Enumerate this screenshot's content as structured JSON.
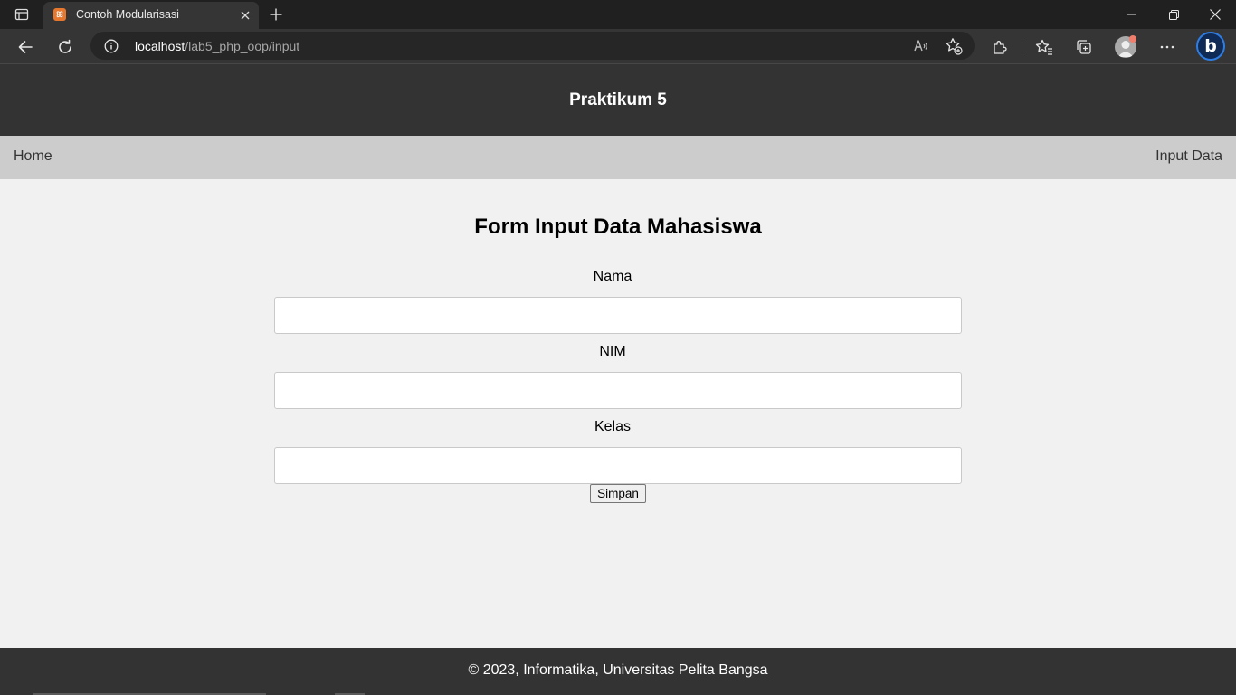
{
  "browser": {
    "tab": {
      "title": "Contoh Modularisasi",
      "favicon_glyph": "ꕤ",
      "favicon_color": "#e8772e"
    },
    "address": {
      "host": "localhost",
      "path": "/lab5_php_oop/input"
    },
    "bing_glyph": "b",
    "icons": {
      "tab_actions": "tab-actions-icon",
      "close": "close-icon",
      "new_tab": "plus-icon",
      "minimize": "minimize-icon",
      "restore": "restore-icon",
      "window_close": "window-close-icon",
      "back": "back-arrow-icon",
      "refresh": "refresh-icon",
      "info": "info-icon",
      "read_aloud": "read-aloud-icon",
      "add_favorite": "star-plus-icon",
      "extensions": "puzzle-icon",
      "favorites": "favorites-icon",
      "collections": "collections-icon",
      "profile": "profile-icon",
      "more": "more-icon",
      "copilot": "bing-icon"
    }
  },
  "page": {
    "header_title": "Praktikum 5",
    "nav": {
      "home": "Home",
      "input": "Input Data"
    },
    "form": {
      "title": "Form Input Data Mahasiswa",
      "fields": [
        {
          "label": "Nama",
          "value": ""
        },
        {
          "label": "NIM",
          "value": ""
        },
        {
          "label": "Kelas",
          "value": ""
        }
      ],
      "submit_label": "Simpan"
    },
    "footer": "© 2023, Informatika, Universitas Pelita Bangsa"
  },
  "colors": {
    "header_bg": "#333333",
    "nav_bg": "#cccccc",
    "page_bg": "#f1f1f1",
    "footer_bg": "#333333"
  }
}
